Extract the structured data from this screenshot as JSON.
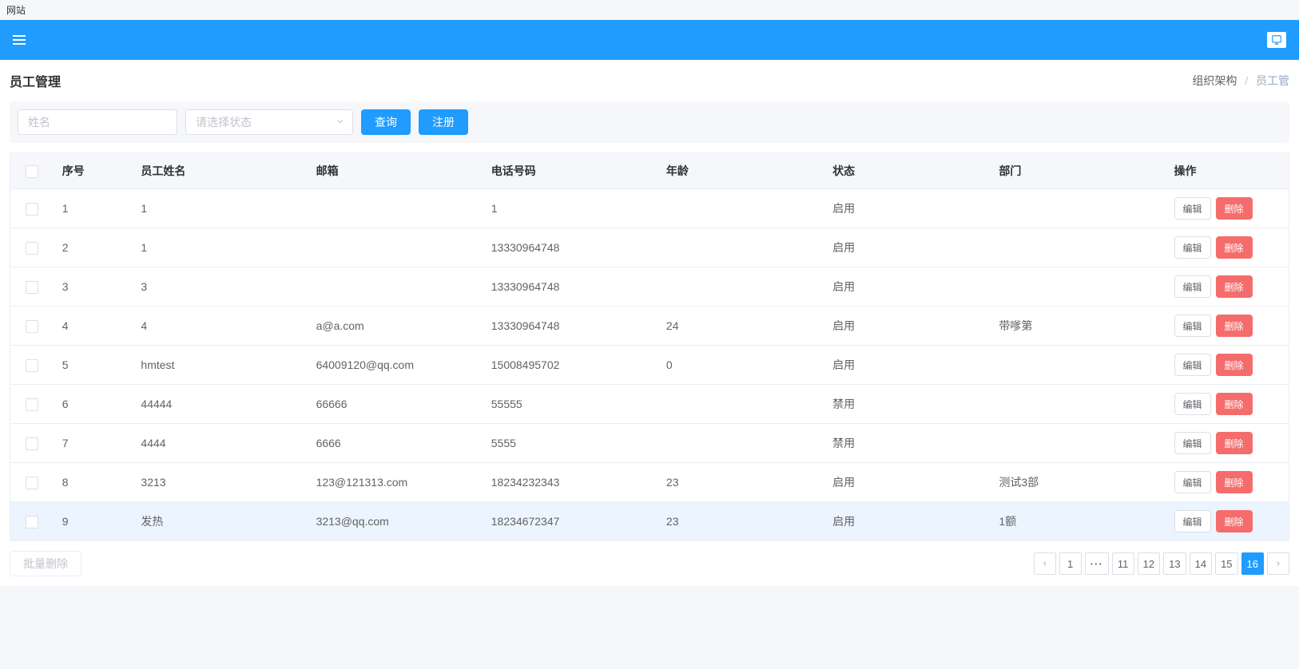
{
  "browser": {
    "tab_title": "网站"
  },
  "header": {
    "page_title": "员工管理",
    "breadcrumb": {
      "parent": "组织架构",
      "current": "员工管"
    }
  },
  "filter": {
    "name_placeholder": "姓名",
    "status_placeholder": "请选择状态",
    "search_label": "查询",
    "register_label": "注册"
  },
  "table": {
    "columns": {
      "index": "序号",
      "name": "员工姓名",
      "email": "邮箱",
      "phone": "电话号码",
      "age": "年龄",
      "status": "状态",
      "dept": "部门",
      "actions": "操作"
    },
    "action_labels": {
      "edit": "编辑",
      "delete": "删除"
    },
    "rows": [
      {
        "index": "1",
        "name": "1",
        "email": "",
        "phone": "1",
        "age": "",
        "status": "启用",
        "dept": ""
      },
      {
        "index": "2",
        "name": "1",
        "email": "",
        "phone": "13330964748",
        "age": "",
        "status": "启用",
        "dept": ""
      },
      {
        "index": "3",
        "name": "3",
        "email": "",
        "phone": "13330964748",
        "age": "",
        "status": "启用",
        "dept": ""
      },
      {
        "index": "4",
        "name": "4",
        "email": "a@a.com",
        "phone": "13330964748",
        "age": "24",
        "status": "启用",
        "dept": "带嗲第"
      },
      {
        "index": "5",
        "name": "hmtest",
        "email": "64009120@qq.com",
        "phone": "15008495702",
        "age": "0",
        "status": "启用",
        "dept": ""
      },
      {
        "index": "6",
        "name": "44444",
        "email": "66666",
        "phone": "55555",
        "age": "",
        "status": "禁用",
        "dept": ""
      },
      {
        "index": "7",
        "name": "4444",
        "email": "6666",
        "phone": "5555",
        "age": "",
        "status": "禁用",
        "dept": ""
      },
      {
        "index": "8",
        "name": "3213",
        "email": "123@121313.com",
        "phone": "18234232343",
        "age": "23",
        "status": "启用",
        "dept": "测试3部"
      },
      {
        "index": "9",
        "name": "发热",
        "email": "3213@qq.com",
        "phone": "18234672347",
        "age": "23",
        "status": "启用",
        "dept": "1额"
      }
    ]
  },
  "footer": {
    "batch_delete_label": "批量删除",
    "pagination": {
      "pages": [
        "1",
        "11",
        "12",
        "13",
        "14",
        "15",
        "16"
      ],
      "active": "16",
      "ellipsis": "···"
    }
  }
}
